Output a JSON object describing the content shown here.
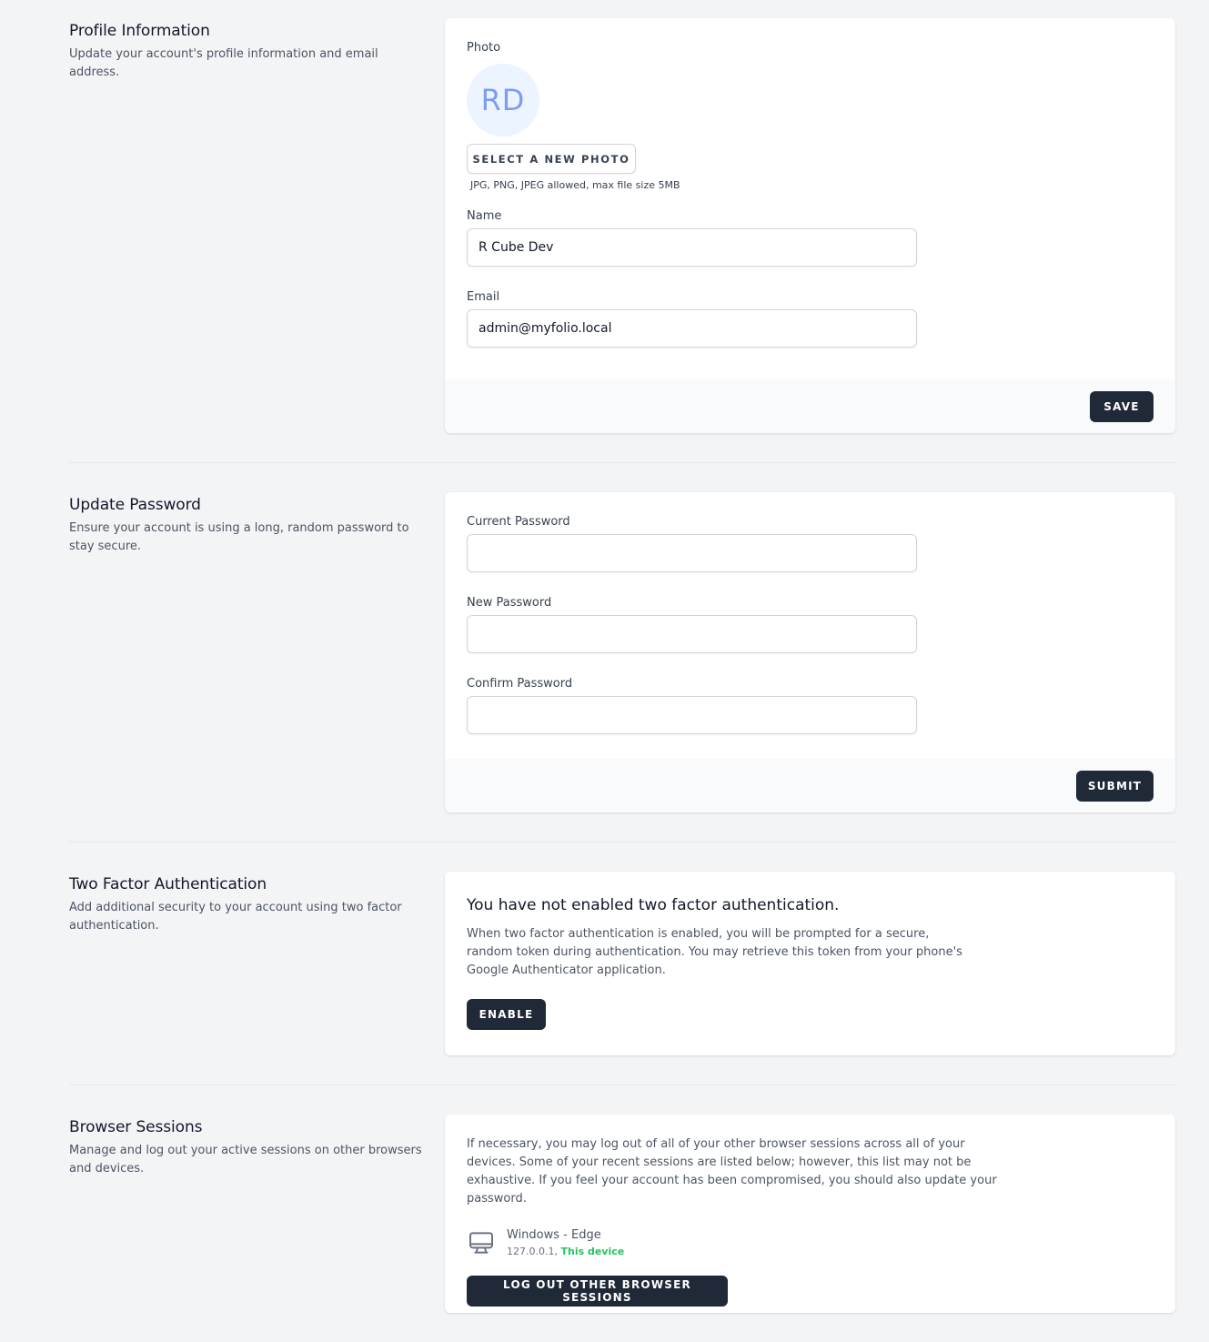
{
  "profile": {
    "title": "Profile Information",
    "description": "Update your account's profile information and email address.",
    "photo_label": "Photo",
    "avatar_initials": "RD",
    "select_photo_label": "SELECT A NEW PHOTO",
    "photo_hint": "JPG, PNG, JPEG allowed, max file size 5MB",
    "name_label": "Name",
    "name_value": "R Cube Dev",
    "email_label": "Email",
    "email_value": "admin@myfolio.local",
    "save_label": "SAVE"
  },
  "password": {
    "title": "Update Password",
    "description": "Ensure your account is using a long, random password to stay secure.",
    "current_label": "Current Password",
    "current_value": "",
    "new_label": "New Password",
    "new_value": "",
    "confirm_label": "Confirm Password",
    "confirm_value": "",
    "submit_label": "SUBMIT"
  },
  "two_factor": {
    "title": "Two Factor Authentication",
    "description": "Add additional security to your account using two factor authentication.",
    "status_heading": "You have not enabled two factor authentication.",
    "info": "When two factor authentication is enabled, you will be prompted for a secure, random token during authentication. You may retrieve this token from your phone's Google Authenticator application.",
    "enable_label": "ENABLE"
  },
  "sessions": {
    "title": "Browser Sessions",
    "description": "Manage and log out your active sessions on other browsers and devices.",
    "info": "If necessary, you may log out of all of your other browser sessions across all of your devices. Some of your recent sessions are listed below; however, this list may not be exhaustive. If you feel your account has been compromised, you should also update your password.",
    "items": [
      {
        "icon": "desktop-icon",
        "platform": "Windows - Edge",
        "ip": "127.0.0.1,",
        "current_label": "This device"
      }
    ],
    "logout_label": "LOG OUT OTHER BROWSER SESSIONS"
  },
  "colors": {
    "accent_dark": "#1f2937",
    "current_device_green": "#22c55e",
    "avatar_bg": "#ebf4ff",
    "avatar_text": "#7f9cf5"
  }
}
